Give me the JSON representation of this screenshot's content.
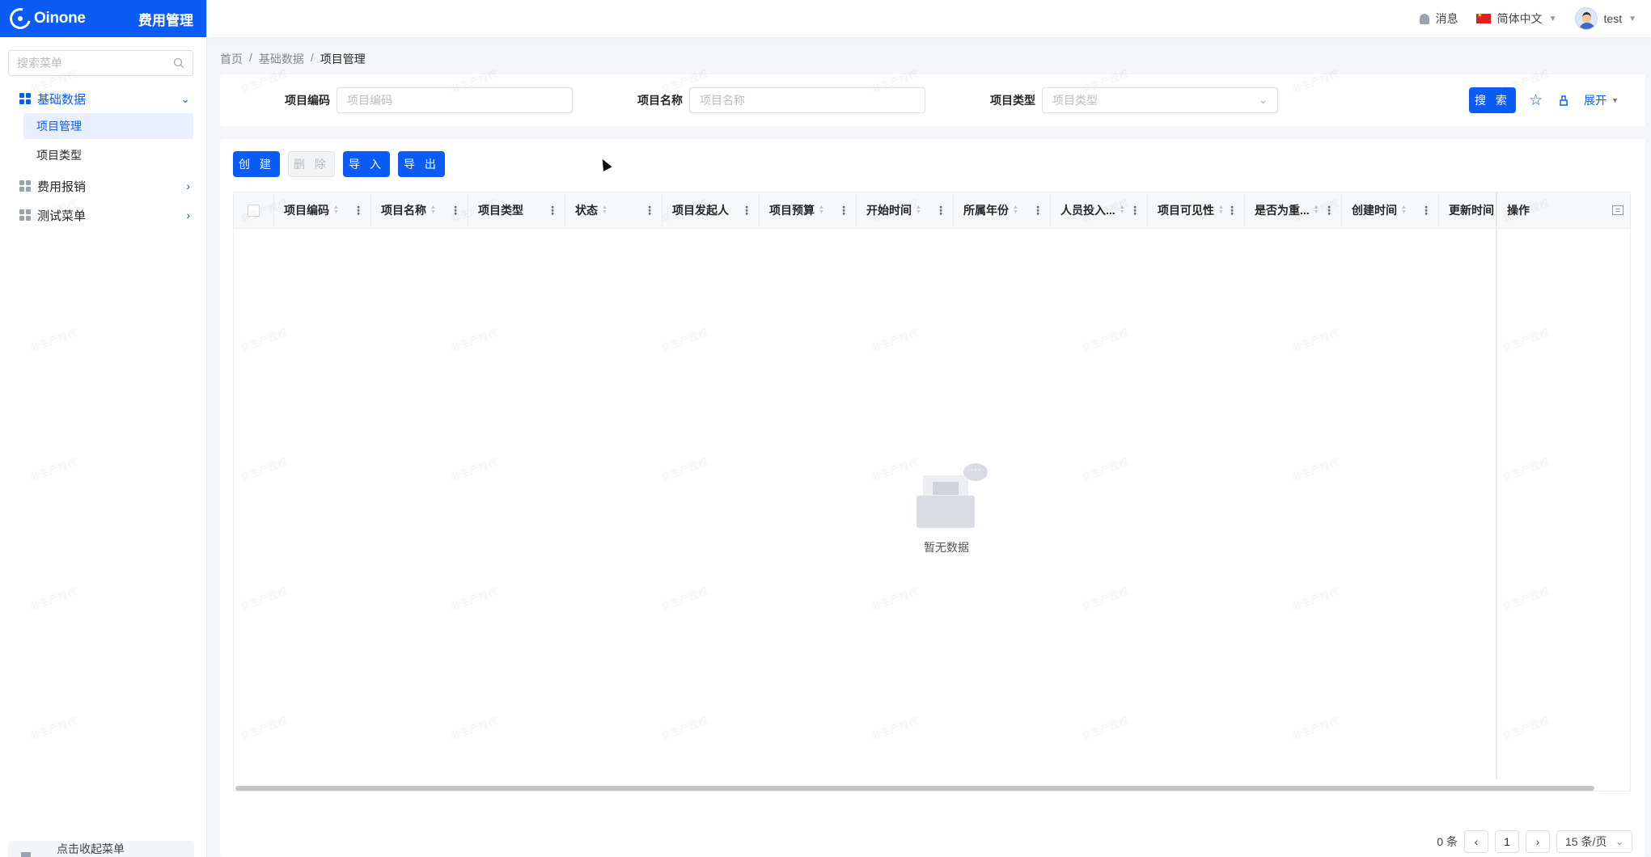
{
  "brand": {
    "logo_text": "Oinone",
    "module_title": "费用管理"
  },
  "menu_search": {
    "placeholder": "搜索菜单"
  },
  "menu": {
    "groups": [
      {
        "label": "基础数据",
        "expanded": true
      },
      {
        "label": "费用报销",
        "expanded": false
      },
      {
        "label": "测试菜单",
        "expanded": false
      }
    ],
    "subitems": [
      {
        "label": "项目管理"
      },
      {
        "label": "项目类型"
      }
    ],
    "collapse_label": "点击收起菜单"
  },
  "topbar": {
    "messages": "消息",
    "language": "简体中文",
    "username": "test"
  },
  "breadcrumb": [
    "首页",
    "基础数据",
    "项目管理"
  ],
  "filter": {
    "fields": [
      {
        "label": "项目编码",
        "placeholder": "项目编码"
      },
      {
        "label": "项目名称",
        "placeholder": "项目名称"
      },
      {
        "label": "项目类型",
        "placeholder": "项目类型"
      }
    ],
    "search_label": "搜 索",
    "expand_label": "展开"
  },
  "toolbar": {
    "create": "创 建",
    "delete": "删 除",
    "import": "导 入",
    "export": "导 出"
  },
  "table": {
    "columns": [
      "项目编码",
      "项目名称",
      "项目类型",
      "状态",
      "项目发起人",
      "项目预算",
      "开始时间",
      "所属年份",
      "人员投入...",
      "项目可见性",
      "是否为重...",
      "创建时间",
      "更新时间"
    ],
    "ops_header": "操作",
    "empty_text": "暂无数据"
  },
  "pagination": {
    "total": "0 条",
    "current_page": "1",
    "page_size": "15 条/页"
  },
  "watermark": "非生产授权",
  "colors": {
    "primary": "#0b5cf5",
    "active_bg": "#e8efff"
  }
}
